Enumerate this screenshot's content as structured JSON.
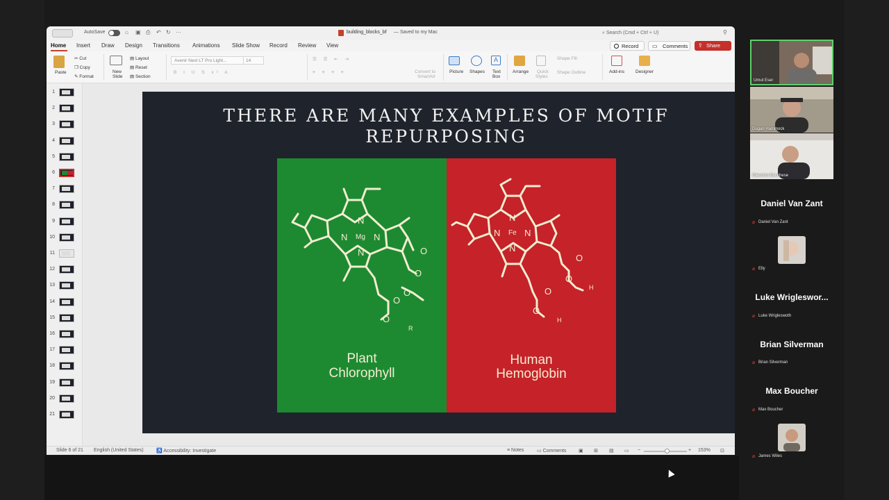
{
  "window": {
    "autosave_label": "AutoSave",
    "doc_title": "building_blocks_bf",
    "doc_status": "— Saved to my Mac",
    "search_placeholder": "Search (Cmd + Ctrl + U)"
  },
  "tabs": [
    "Home",
    "Insert",
    "Draw",
    "Design",
    "Transitions",
    "Animations",
    "Slide Show",
    "Record",
    "Review",
    "View"
  ],
  "buttons": {
    "record": "Record",
    "comments": "Comments",
    "share": "Share"
  },
  "ribbon": {
    "paste": "Paste",
    "cut": "Cut",
    "copy": "Copy",
    "format": "Format",
    "new_slide_1": "New",
    "new_slide_2": "Slide",
    "layout": "Layout",
    "reset": "Reset",
    "section": "Section",
    "font": "Avenir Next LT Pro Light...",
    "size": "14",
    "convert_1": "Convert to",
    "convert_2": "SmartArt",
    "picture": "Picture",
    "shapes": "Shapes",
    "textbox_1": "Text",
    "textbox_2": "Box",
    "arrange": "Arrange",
    "quick_1": "Quick",
    "quick_2": "Styles",
    "shape_fill": "Shape Fill",
    "shape_outline": "Shape Outline",
    "addins": "Add-ins",
    "designer": "Designer"
  },
  "thumbnails": {
    "numbers": [
      "1",
      "2",
      "3",
      "4",
      "5",
      "6",
      "7",
      "8",
      "9",
      "10",
      "11",
      "12",
      "13",
      "14",
      "15",
      "16",
      "17",
      "18",
      "19",
      "20",
      "21"
    ],
    "selected_index": 6
  },
  "slide": {
    "title_line1": "THERE ARE MANY EXAMPLES OF MOTIF",
    "title_line2": "REPURPOSING",
    "left_label_1": "Plant",
    "left_label_2": "Chlorophyll",
    "right_label_1": "Human",
    "right_label_2": "Hemoglobin",
    "left_metal": "Mg",
    "right_metal": "Fe",
    "nitrogen": "N",
    "oxygen": "O",
    "left_r": "R",
    "right_h": "H",
    "panel_colors": {
      "left": "#1d8a32",
      "right": "#c5222a"
    }
  },
  "status": {
    "slide_of": "Slide 6 of 21",
    "language": "English (United States)",
    "accessibility": "Accessibility: Investigate",
    "notes": "Notes",
    "comments": "Comments",
    "zoom": "153%"
  },
  "participants": {
    "cam1": "Umut Eser",
    "cam2": "Dugan Hammock",
    "cam3": "Giacomo Bocchese",
    "tiles": [
      {
        "big": "Daniel Van Zant",
        "small": "Daniel Van Zant"
      },
      {
        "small": "Elly"
      },
      {
        "big": "Luke  Wrigleswor...",
        "small": "Luke Wrigleswoth"
      },
      {
        "big": "Brian Silverman",
        "small": "Brian Silverman"
      },
      {
        "big": "Max Boucher",
        "small": "Max Boucher"
      },
      {
        "small": "James Wiles"
      }
    ]
  }
}
